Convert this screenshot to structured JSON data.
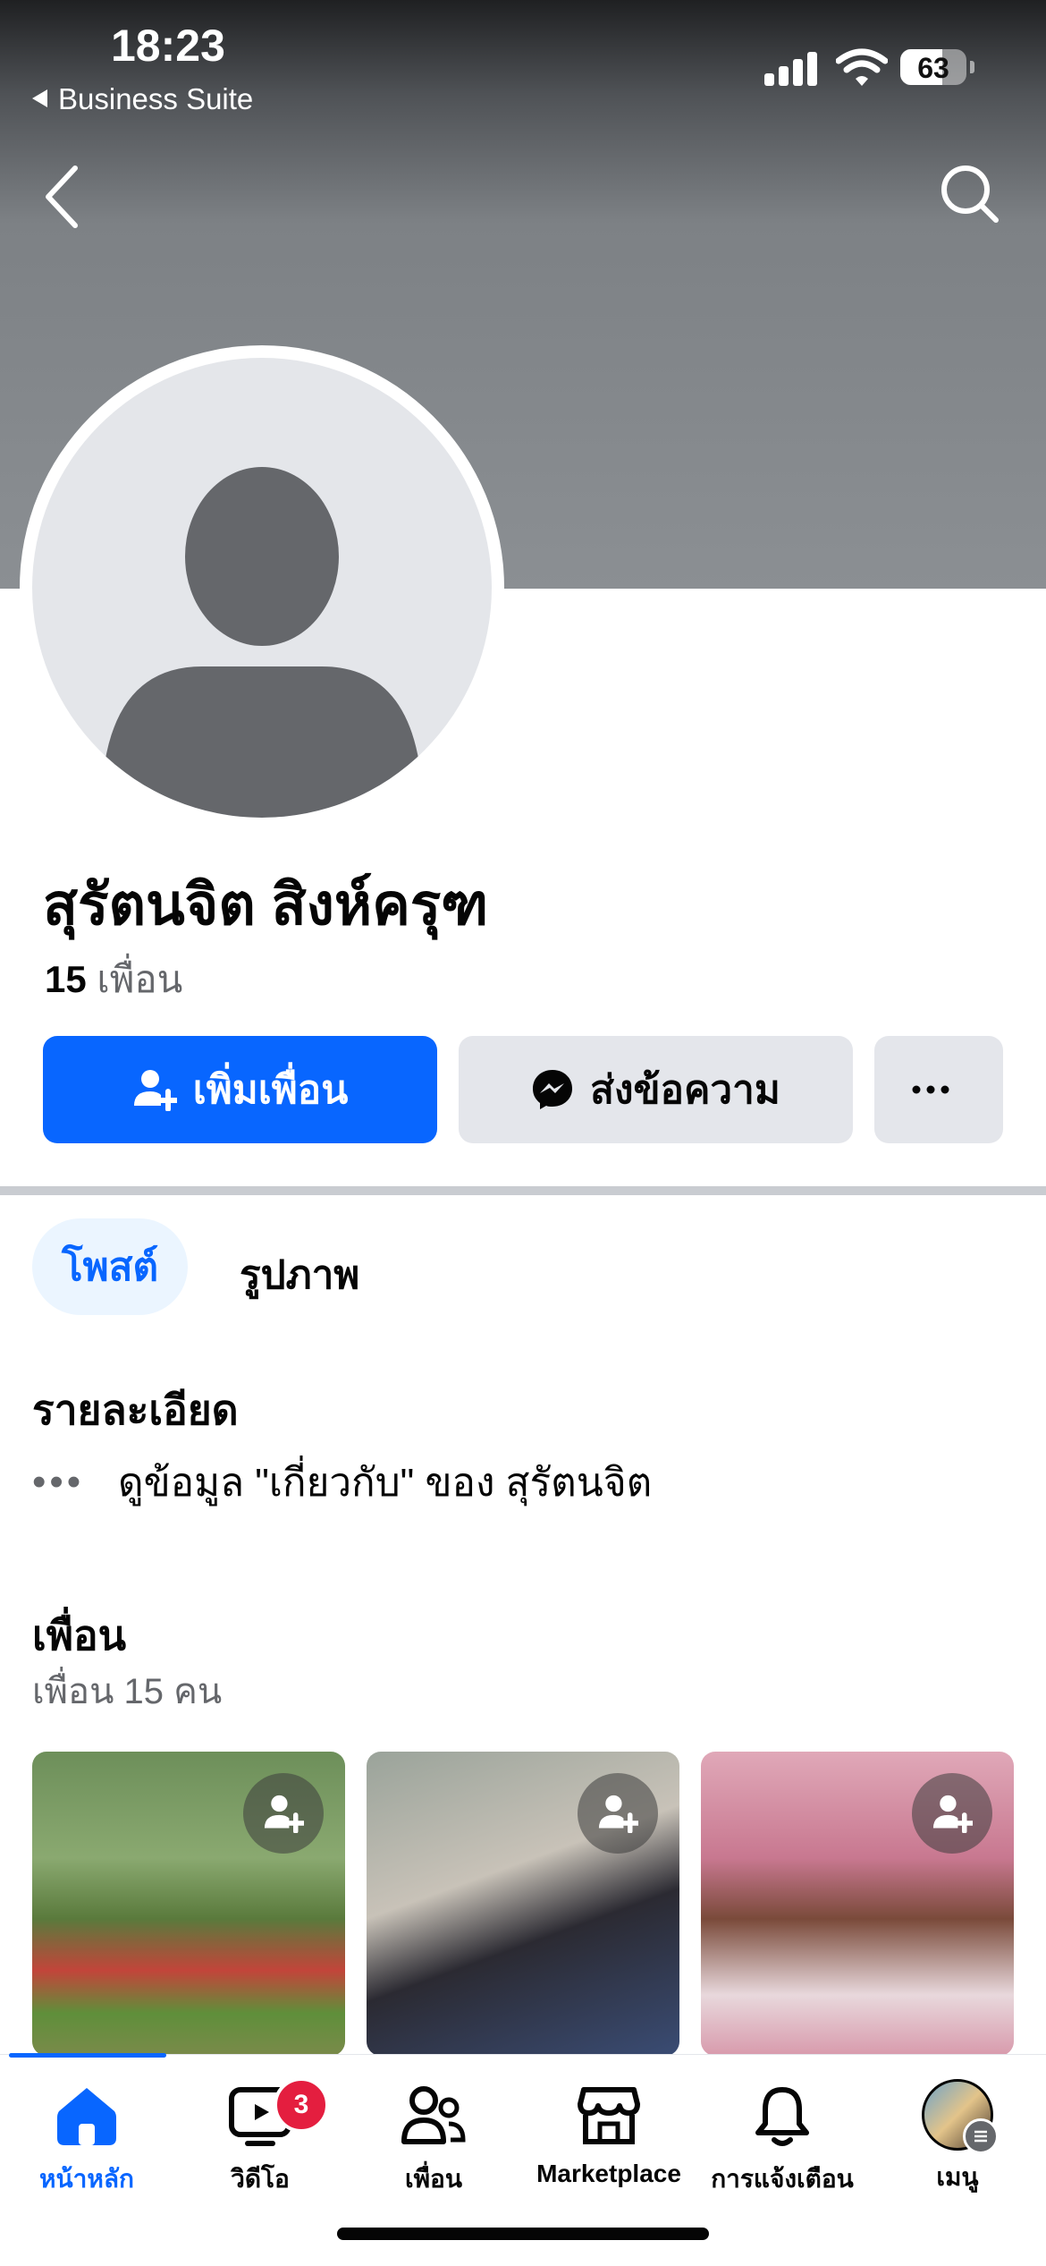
{
  "status_bar": {
    "time": "18:23",
    "back_app": "Business Suite",
    "battery": "63"
  },
  "profile": {
    "name": "สุรัตนจิต สิงห์ครุฑ",
    "friends_count": "15",
    "friends_label": "เพื่อน"
  },
  "actions": {
    "add_friend": "เพิ่มเพื่อน",
    "message": "ส่งข้อความ"
  },
  "tabs": {
    "posts": "โพสต์",
    "photos": "รูปภาพ"
  },
  "details": {
    "title": "รายละเอียด",
    "about_link": "ดูข้อมูล \"เกี่ยวกับ\" ของ สุรัตนจิต"
  },
  "friends": {
    "title": "เพื่อน",
    "subtitle": "เพื่อน 15 คน"
  },
  "tabbar": {
    "home": "หน้าหลัก",
    "video": "วิดีโอ",
    "video_badge": "3",
    "friends": "เพื่อน",
    "marketplace": "Marketplace",
    "notifications": "การแจ้งเตือน",
    "menu": "เมนู"
  },
  "colors": {
    "accent": "#0866ff",
    "badge": "#e41e3f",
    "button_gray": "#e4e6eb"
  }
}
